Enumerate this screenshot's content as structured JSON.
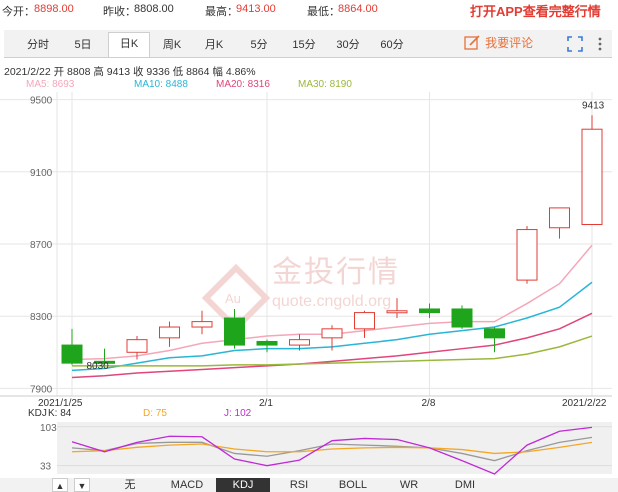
{
  "header": {
    "open_label": "今开：",
    "open_value": "8898.00",
    "prev_close_label": "昨收：",
    "prev_close_value": "8808.00",
    "high_label": "最高：",
    "high_value": "9413.00",
    "low_label": "最低：",
    "low_value": "8864.00",
    "app_promo": "打开APP查看完整行情"
  },
  "tabs": [
    "分时",
    "5日",
    "日K",
    "周K",
    "月K",
    "5分",
    "15分",
    "30分",
    "60分"
  ],
  "active_tab": "日K",
  "comment_label": "我要评论",
  "icons": {
    "comment": "edit-icon",
    "fullscreen": "fullscreen-icon",
    "more": "more-vertical-icon"
  },
  "info_line": "2021/2/22  开 8808  高 9413  收 9336  低 8864  幅 4.86%",
  "ma_legend": [
    {
      "label": "MA5: 8693",
      "color": "#f4a7b9"
    },
    {
      "label": "MA10: 8488",
      "color": "#29b6d6"
    },
    {
      "label": "MA20: 8316",
      "color": "#e0457b"
    },
    {
      "label": "MA30: 8190",
      "color": "#9ab83a"
    }
  ],
  "watermark": {
    "brand": "金投行情",
    "url": "quote.cngold.org",
    "badge": "Au"
  },
  "kdj_legend": {
    "title": "KDJ",
    "k": {
      "label": "K: 84",
      "color": "#999999"
    },
    "d": {
      "label": "D: 75",
      "color": "#f5a623"
    },
    "j": {
      "label": "J: 102",
      "color": "#c02ad6"
    }
  },
  "indicator_tabs": [
    "无",
    "MACD",
    "KDJ",
    "RSI",
    "BOLL",
    "WR",
    "DMI"
  ],
  "active_indicator": "KDJ",
  "pager": {
    "up": "▲",
    "down": "▼"
  },
  "chart_data": {
    "type": "candlestick",
    "y_ticks": [
      9500,
      9100,
      8700,
      8300,
      7900
    ],
    "ylim": [
      7880,
      9520
    ],
    "x_labels": [
      {
        "index": 0,
        "label": "2021/1/25"
      },
      {
        "index": 6,
        "label": "2/1"
      },
      {
        "index": 11,
        "label": "2/8"
      },
      {
        "index": 16,
        "label": "2021/2/22"
      }
    ],
    "annotations": [
      {
        "index": 1,
        "value": 8030,
        "label": "8030"
      },
      {
        "index": 16,
        "value": 9413,
        "label": "9413"
      }
    ],
    "candles": [
      {
        "date": "2021/1/25",
        "open": 8140,
        "close": 8040,
        "high": 8230,
        "low": 8030
      },
      {
        "date": "",
        "open": 8050,
        "close": 8040,
        "high": 8120,
        "low": 8030
      },
      {
        "date": "",
        "open": 8100,
        "close": 8170,
        "high": 8190,
        "low": 8060
      },
      {
        "date": "",
        "open": 8180,
        "close": 8240,
        "high": 8270,
        "low": 8130
      },
      {
        "date": "",
        "open": 8240,
        "close": 8270,
        "high": 8330,
        "low": 8200
      },
      {
        "date": "2/1",
        "open": 8290,
        "close": 8140,
        "high": 8340,
        "low": 8120
      },
      {
        "date": "",
        "open": 8160,
        "close": 8140,
        "high": 8170,
        "low": 8100
      },
      {
        "date": "",
        "open": 8140,
        "close": 8170,
        "high": 8200,
        "low": 8110
      },
      {
        "date": "",
        "open": 8180,
        "close": 8230,
        "high": 8250,
        "low": 8110
      },
      {
        "date": "",
        "open": 8230,
        "close": 8320,
        "high": 8330,
        "low": 8180
      },
      {
        "date": "",
        "open": 8320,
        "close": 8330,
        "high": 8400,
        "low": 8290
      },
      {
        "date": "2/8",
        "open": 8340,
        "close": 8320,
        "high": 8370,
        "low": 8290
      },
      {
        "date": "",
        "open": 8340,
        "close": 8240,
        "high": 8360,
        "low": 8230
      },
      {
        "date": "",
        "open": 8230,
        "close": 8180,
        "high": 8240,
        "low": 8100
      },
      {
        "date": "",
        "open": 8500,
        "close": 8780,
        "high": 8800,
        "low": 8480
      },
      {
        "date": "",
        "open": 8790,
        "close": 8900,
        "high": 8900,
        "low": 8730
      },
      {
        "date": "2021/2/22",
        "open": 8808,
        "close": 9336,
        "high": 9413,
        "low": 8864
      }
    ],
    "ma_series": [
      {
        "name": "MA5",
        "color": "#f4a7b9",
        "values": [
          8060,
          8065,
          8080,
          8110,
          8150,
          8170,
          8190,
          8200,
          8200,
          8220,
          8240,
          8260,
          8270,
          8270,
          8370,
          8480,
          8693
        ]
      },
      {
        "name": "MA10",
        "color": "#29b6d6",
        "values": [
          8000,
          8010,
          8040,
          8070,
          8080,
          8110,
          8120,
          8120,
          8130,
          8150,
          8170,
          8200,
          8220,
          8240,
          8290,
          8350,
          8488
        ]
      },
      {
        "name": "MA20",
        "color": "#e0457b",
        "values": [
          7960,
          7970,
          7985,
          7995,
          8005,
          8015,
          8025,
          8035,
          8050,
          8065,
          8080,
          8100,
          8120,
          8140,
          8180,
          8230,
          8316
        ]
      },
      {
        "name": "MA30",
        "color": "#9ab83a",
        "values": [
          8025,
          8025,
          8025,
          8025,
          8025,
          8030,
          8030,
          8035,
          8040,
          8045,
          8050,
          8055,
          8060,
          8065,
          8090,
          8130,
          8190
        ]
      }
    ],
    "kdj": {
      "y_ticks": [
        103,
        33
      ],
      "ylim": [
        18,
        108
      ],
      "k": [
        65,
        60,
        73,
        75,
        75,
        55,
        50,
        60,
        72,
        70,
        68,
        65,
        55,
        42,
        60,
        75,
        84
      ],
      "d": [
        58,
        60,
        66,
        70,
        72,
        63,
        58,
        58,
        63,
        65,
        66,
        65,
        62,
        55,
        58,
        66,
        75
      ],
      "j": [
        76,
        58,
        75,
        86,
        85,
        45,
        33,
        43,
        78,
        82,
        80,
        65,
        42,
        18,
        70,
        95,
        102
      ]
    }
  }
}
